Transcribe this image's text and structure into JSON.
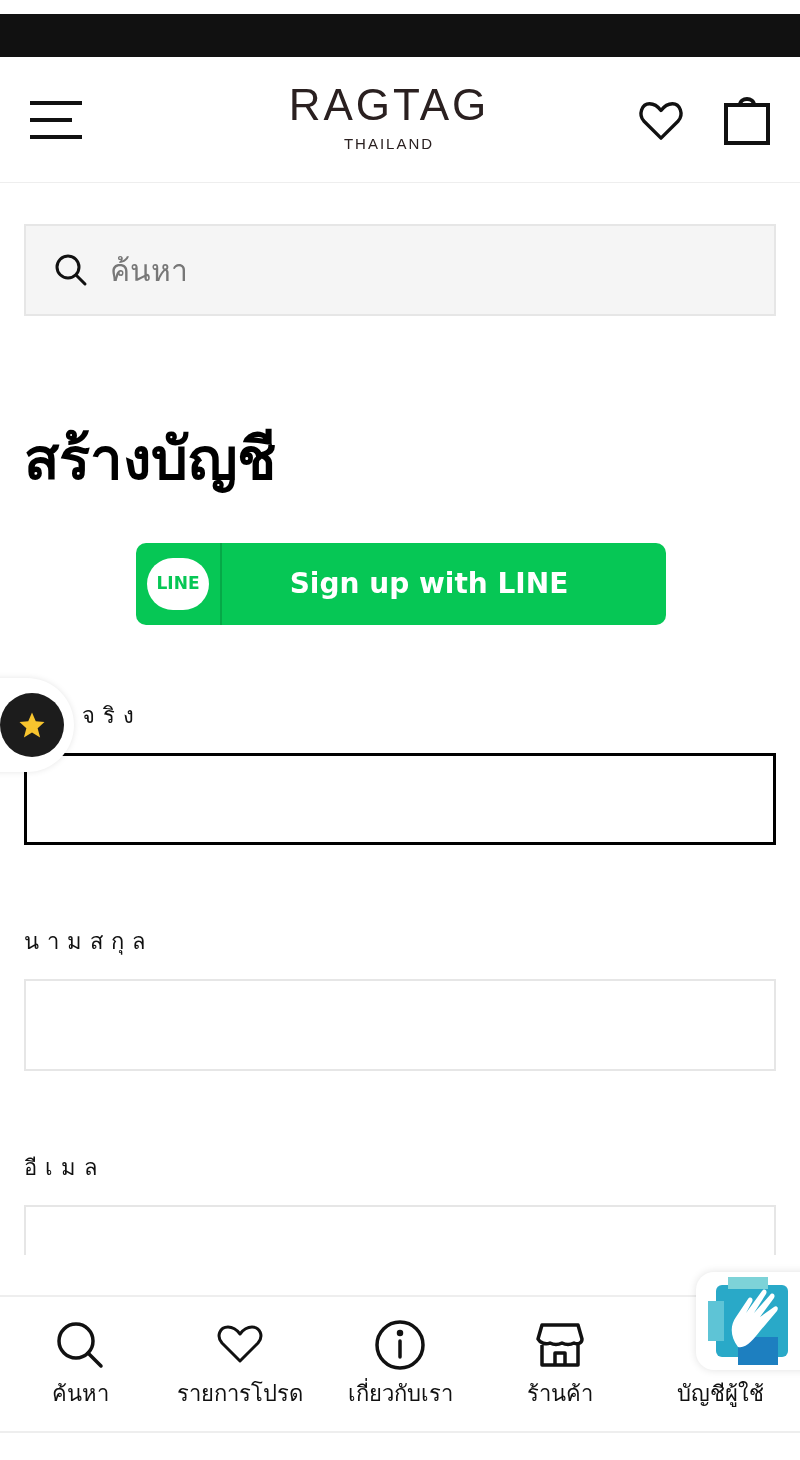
{
  "header": {
    "logo": "RAGTAG",
    "logo_sub": "THAILAND"
  },
  "search": {
    "placeholder": "ค้นหา"
  },
  "title": "สร้างบัญชี",
  "line_button": {
    "badge": "LINE",
    "label": "Sign up with LINE"
  },
  "fields": [
    {
      "label": "จริง",
      "focused": true
    },
    {
      "label": "นามสกุล",
      "focused": false
    },
    {
      "label": "อีเมล",
      "focused": false
    }
  ],
  "bottom_nav": [
    {
      "kind": "search",
      "label": "ค้นหา"
    },
    {
      "kind": "heart",
      "label": "รายการโปรด"
    },
    {
      "kind": "info",
      "label": "เกี่ยวกับเรา"
    },
    {
      "kind": "store",
      "label": "ร้านค้า"
    },
    {
      "kind": "account",
      "label": "บัญชีผู้ใช้"
    }
  ]
}
